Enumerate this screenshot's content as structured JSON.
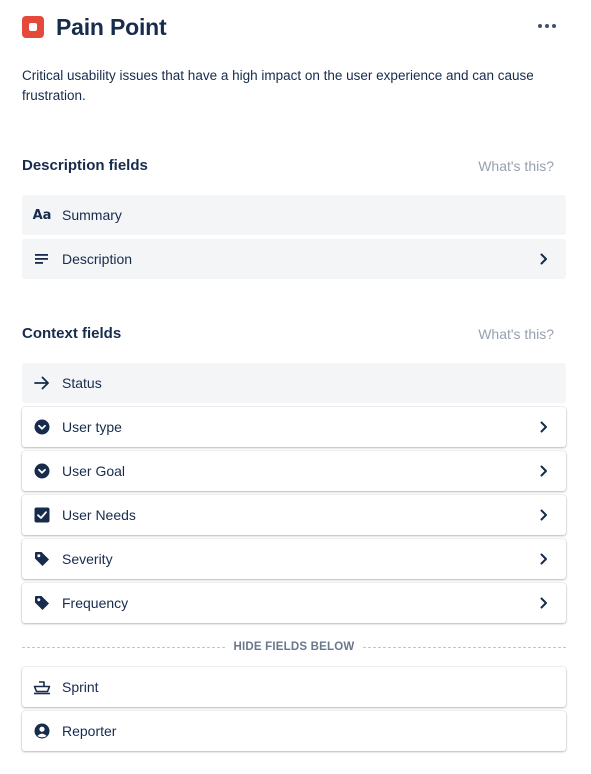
{
  "header": {
    "title": "Pain Point",
    "description": "Critical usability issues that have a high impact on the user experience and can cause frustration."
  },
  "sections": {
    "description": {
      "title": "Description fields",
      "help": "What's this?"
    },
    "context": {
      "title": "Context fields",
      "help": "What's this?"
    }
  },
  "description_fields": [
    {
      "label": "Summary",
      "icon": "text-aa-icon"
    },
    {
      "label": "Description",
      "icon": "lines-icon"
    }
  ],
  "context_fields": [
    {
      "label": "Status",
      "icon": "arrow-right-icon"
    },
    {
      "label": "User type",
      "icon": "chevron-circle-icon"
    },
    {
      "label": "User Goal",
      "icon": "chevron-circle-icon"
    },
    {
      "label": "User Needs",
      "icon": "checkbox-icon"
    },
    {
      "label": "Severity",
      "icon": "tag-icon"
    },
    {
      "label": "Frequency",
      "icon": "tag-icon"
    }
  ],
  "divider": {
    "label": "HIDE FIELDS BELOW"
  },
  "hidden_fields": [
    {
      "label": "Sprint",
      "icon": "sprint-icon"
    },
    {
      "label": "Reporter",
      "icon": "person-circle-icon"
    }
  ],
  "colors": {
    "issue_type": "#e5493a",
    "text": "#172b4d",
    "muted": "#97a0af",
    "field_bg": "#f4f5f7"
  }
}
